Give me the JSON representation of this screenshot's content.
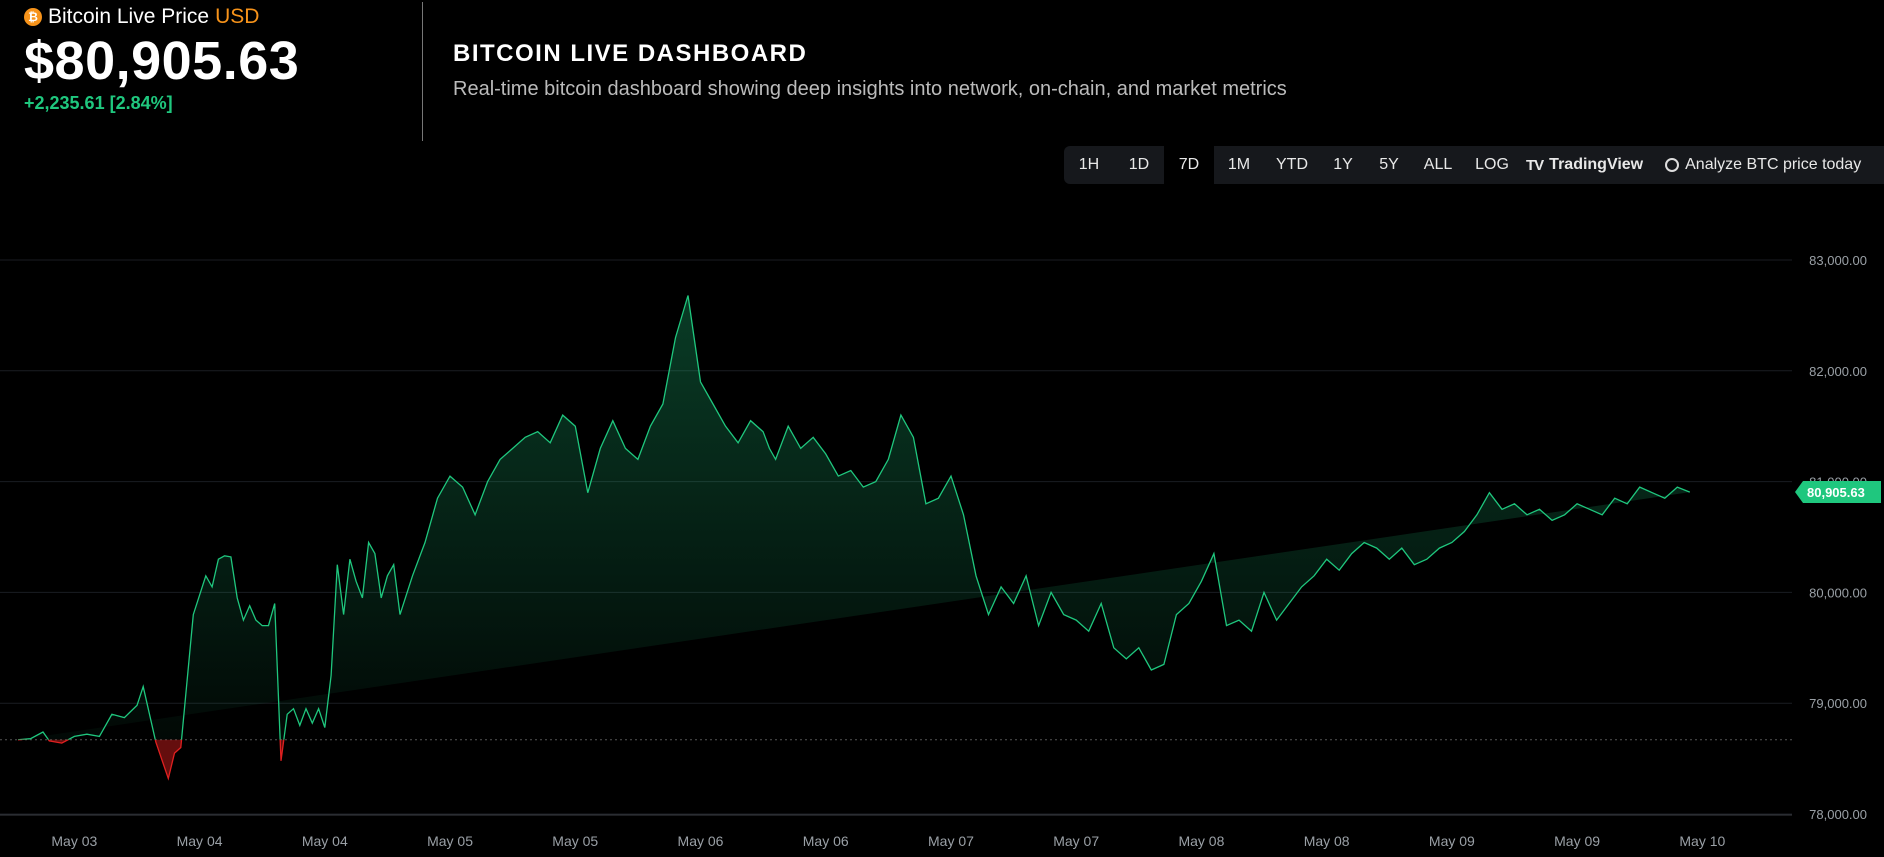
{
  "header": {
    "label": "Bitcoin Live Price",
    "currency": "USD",
    "coin_glyph": "₿",
    "price": "$80,905.63",
    "change": "+2,235.61 [2.84%]"
  },
  "dashboard": {
    "title": "BITCOIN LIVE DASHBOARD",
    "subtitle": "Real-time bitcoin dashboard showing deep insights into network, on-chain, and market metrics"
  },
  "toolbar": {
    "ranges": [
      "1H",
      "1D",
      "7D",
      "1M",
      "YTD",
      "1Y",
      "5Y",
      "ALL"
    ],
    "active_range": "7D",
    "log_label": "LOG",
    "tradingview_label": "TradingView",
    "tradingview_icon": "tradingview-logo-icon",
    "analyze_label": "Analyze BTC price today",
    "analyze_icon": "openai-logo-icon"
  },
  "colors": {
    "up": "#1fc77e",
    "down": "#e02020",
    "accent": "#f7931a",
    "grid": "#1a1d22"
  },
  "chart_data": {
    "type": "area",
    "baseline": 78670,
    "last_value": 80905.63,
    "last_value_label": "80,905.63",
    "ylim": [
      78000,
      83000
    ],
    "yticks": [
      78000,
      79000,
      80000,
      81000,
      82000,
      83000
    ],
    "ytick_labels": [
      "78,000.00",
      "79,000.00",
      "80,000.00",
      "81,000.00",
      "82,000.00",
      "83,000.00"
    ],
    "x_tick_labels": [
      "May 03",
      "May 04",
      "May 04",
      "May 05",
      "May 05",
      "May 06",
      "May 06",
      "May 07",
      "May 07",
      "May 08",
      "May 08",
      "May 09",
      "May 09",
      "May 10"
    ],
    "x_tick_positions": [
      0.5,
      1.5,
      2.5,
      3.5,
      4.5,
      5.5,
      6.5,
      7.5,
      8.5,
      9.5,
      10.5,
      11.5,
      12.5,
      13.5
    ],
    "xlim": [
      0.05,
      14.2
    ],
    "x": [
      0.05,
      0.15,
      0.25,
      0.3,
      0.4,
      0.5,
      0.6,
      0.7,
      0.8,
      0.9,
      1.0,
      1.05,
      1.15,
      1.25,
      1.3,
      1.35,
      1.45,
      1.55,
      1.6,
      1.65,
      1.7,
      1.75,
      1.8,
      1.85,
      1.9,
      1.95,
      2.0,
      2.05,
      2.1,
      2.15,
      2.2,
      2.25,
      2.3,
      2.35,
      2.4,
      2.45,
      2.5,
      2.55,
      2.6,
      2.65,
      2.7,
      2.75,
      2.8,
      2.85,
      2.9,
      2.95,
      3.0,
      3.05,
      3.1,
      3.2,
      3.3,
      3.4,
      3.5,
      3.6,
      3.7,
      3.8,
      3.9,
      4.0,
      4.1,
      4.2,
      4.3,
      4.4,
      4.5,
      4.6,
      4.7,
      4.8,
      4.9,
      5.0,
      5.1,
      5.2,
      5.3,
      5.4,
      5.5,
      5.6,
      5.7,
      5.8,
      5.9,
      6.0,
      6.05,
      6.1,
      6.2,
      6.3,
      6.4,
      6.5,
      6.6,
      6.7,
      6.8,
      6.9,
      7.0,
      7.1,
      7.2,
      7.3,
      7.4,
      7.5,
      7.6,
      7.7,
      7.8,
      7.9,
      8.0,
      8.1,
      8.2,
      8.3,
      8.4,
      8.5,
      8.6,
      8.7,
      8.8,
      8.9,
      9.0,
      9.1,
      9.2,
      9.3,
      9.4,
      9.5,
      9.6,
      9.7,
      9.8,
      9.9,
      10.0,
      10.1,
      10.2,
      10.3,
      10.4,
      10.5,
      10.6,
      10.7,
      10.8,
      10.9,
      11.0,
      11.1,
      11.2,
      11.3,
      11.4,
      11.5,
      11.6,
      11.7,
      11.8,
      11.9,
      12.0,
      12.1,
      12.2,
      12.3,
      12.4,
      12.5,
      12.6,
      12.7,
      12.8,
      12.9,
      13.0,
      13.1,
      13.2,
      13.3,
      13.4,
      13.5,
      13.6,
      13.7,
      13.8,
      13.9,
      14.0,
      14.1,
      14.2
    ],
    "y": [
      78670,
      78680,
      78740,
      78660,
      78640,
      78700,
      78720,
      78700,
      78900,
      78870,
      78980,
      79150,
      78650,
      78320,
      78550,
      78600,
      79800,
      80150,
      80050,
      80300,
      80330,
      80320,
      79950,
      79750,
      79880,
      79750,
      79700,
      79700,
      79900,
      78480,
      78900,
      78950,
      78800,
      78950,
      78820,
      78950,
      78780,
      79250,
      80250,
      79800,
      80300,
      80100,
      79950,
      80450,
      80350,
      79950,
      80150,
      80250,
      79800,
      80150,
      80450,
      80850,
      81050,
      80950,
      80700,
      81000,
      81200,
      81300,
      81400,
      81450,
      81350,
      81600,
      81500,
      80900,
      81300,
      81550,
      81300,
      81200,
      81500,
      81700,
      82300,
      82680,
      81900,
      81700,
      81500,
      81350,
      81550,
      81450,
      81300,
      81200,
      81500,
      81300,
      81400,
      81250,
      81050,
      81100,
      80950,
      81000,
      81200,
      81600,
      81400,
      80800,
      80850,
      81050,
      80700,
      80150,
      79800,
      80050,
      79900,
      80150,
      79700,
      80000,
      79800,
      79750,
      79650,
      79900,
      79500,
      79400,
      79500,
      79300,
      79350,
      79800,
      79900,
      80100,
      80350,
      79700,
      79750,
      79650,
      80000,
      79750,
      79900,
      80050,
      80150,
      80300,
      80200,
      80350,
      80450,
      80400,
      80300,
      80400,
      80250,
      80300,
      80400,
      80450,
      80550,
      80700,
      80900,
      80750,
      80800,
      80700,
      80750,
      80650,
      80700,
      80800,
      80750,
      80700,
      80850,
      80800,
      80950,
      80900,
      80850,
      80950,
      80905.63
    ]
  }
}
